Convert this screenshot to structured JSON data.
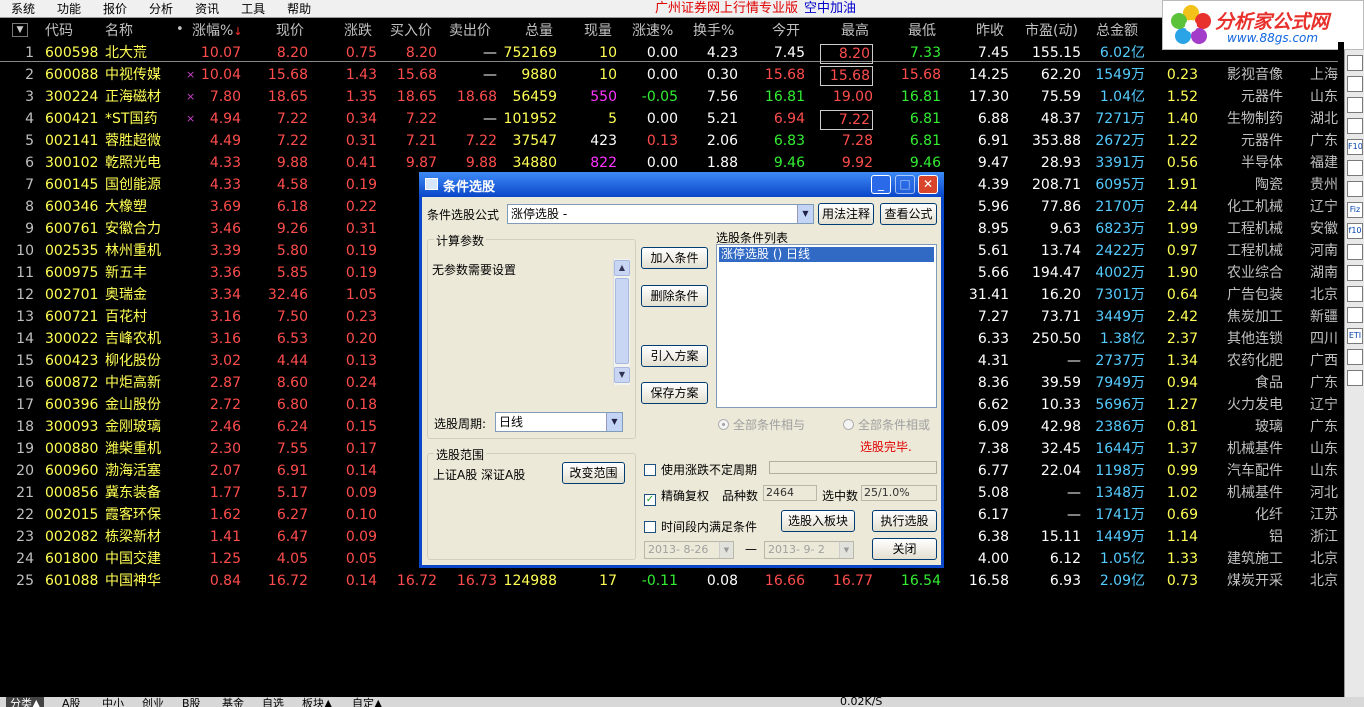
{
  "menu": {
    "items": [
      "系统",
      "功能",
      "报价",
      "分析",
      "资讯",
      "工具",
      "帮助"
    ],
    "title": "广州证券网上行情专业版",
    "subtitle": "空中加油"
  },
  "logo": {
    "name": "分析家公式网",
    "url": "www.88gs.com"
  },
  "table": {
    "headers": {
      "code": "代码",
      "name": "名称",
      "pct": "涨幅%",
      "price": "现价",
      "chg": "涨跌",
      "bid": "买入价",
      "ask": "卖出价",
      "vol": "总量",
      "curvol": "现量",
      "speed": "涨速%",
      "turnover": "换手%",
      "open": "今开",
      "high": "最高",
      "low": "最低",
      "prev": "昨收",
      "pe": "市盈(动)",
      "amount": "总金额",
      "pct_sort_arrow": "↓"
    },
    "rows": [
      {
        "no": "1",
        "code": "600598",
        "name": "北大荒",
        "mark": "",
        "pct": "10.07",
        "price": "8.20",
        "chg": "0.75",
        "bid": "8.20",
        "ask": "—",
        "vol": "752169",
        "curvol": "10",
        "speed": "0.00",
        "turnover": "4.23",
        "open": "7.45",
        "high": "8.20",
        "low": "7.33",
        "prev": "7.45",
        "pe": "155.15",
        "amount": "6.02亿",
        "vr": "",
        "industry": "",
        "region": ""
      },
      {
        "no": "2",
        "code": "600088",
        "name": "中视传媒",
        "mark": "×",
        "pct": "10.04",
        "price": "15.68",
        "chg": "1.43",
        "bid": "15.68",
        "ask": "—",
        "vol": "9880",
        "curvol": "10",
        "speed": "0.00",
        "turnover": "0.30",
        "open": "15.68",
        "high": "15.68",
        "low": "15.68",
        "prev": "14.25",
        "pe": "62.20",
        "amount": "1549万",
        "vr": "0.23",
        "industry": "影视音像",
        "region": "上海"
      },
      {
        "no": "3",
        "code": "300224",
        "name": "正海磁材",
        "mark": "×",
        "pct": "7.80",
        "price": "18.65",
        "chg": "1.35",
        "bid": "18.65",
        "ask": "18.68",
        "vol": "56459",
        "curvol": "550",
        "speed": "-0.05",
        "turnover": "7.56",
        "open": "16.81",
        "high": "19.00",
        "low": "16.81",
        "prev": "17.30",
        "pe": "75.59",
        "amount": "1.04亿",
        "vr": "1.52",
        "industry": "元器件",
        "region": "山东"
      },
      {
        "no": "4",
        "code": "600421",
        "name": "*ST国药",
        "mark": "×",
        "pct": "4.94",
        "price": "7.22",
        "chg": "0.34",
        "bid": "7.22",
        "ask": "—",
        "vol": "101952",
        "curvol": "5",
        "speed": "0.00",
        "turnover": "5.21",
        "open": "6.94",
        "high": "7.22",
        "low": "6.81",
        "prev": "6.88",
        "pe": "48.37",
        "amount": "7271万",
        "vr": "1.40",
        "industry": "生物制药",
        "region": "湖北"
      },
      {
        "no": "5",
        "code": "002141",
        "name": "蓉胜超微",
        "mark": "",
        "pct": "4.49",
        "price": "7.22",
        "chg": "0.31",
        "bid": "7.21",
        "ask": "7.22",
        "vol": "37547",
        "curvol": "423",
        "speed": "0.13",
        "turnover": "2.06",
        "open": "6.83",
        "high": "7.28",
        "low": "6.81",
        "prev": "6.91",
        "pe": "353.88",
        "amount": "2672万",
        "vr": "1.22",
        "industry": "元器件",
        "region": "广东"
      },
      {
        "no": "6",
        "code": "300102",
        "name": "乾照光电",
        "mark": "",
        "pct": "4.33",
        "price": "9.88",
        "chg": "0.41",
        "bid": "9.87",
        "ask": "9.88",
        "vol": "34880",
        "curvol": "822",
        "speed": "0.00",
        "turnover": "1.88",
        "open": "9.46",
        "high": "9.92",
        "low": "9.46",
        "prev": "9.47",
        "pe": "28.93",
        "amount": "3391万",
        "vr": "0.56",
        "industry": "半导体",
        "region": "福建"
      },
      {
        "no": "7",
        "code": "600145",
        "name": "国创能源",
        "mark": "",
        "pct": "4.33",
        "price": "4.58",
        "chg": "0.19",
        "bid": "4",
        "ask": "",
        "vol": "",
        "curvol": "",
        "speed": "",
        "turnover": "",
        "open": "",
        "high": "",
        "low": "",
        "prev": "4.39",
        "pe": "208.71",
        "amount": "6095万",
        "vr": "1.91",
        "industry": "陶瓷",
        "region": "贵州"
      },
      {
        "no": "8",
        "code": "600346",
        "name": "大橡塑",
        "mark": "",
        "pct": "3.69",
        "price": "6.18",
        "chg": "0.22",
        "bid": "6",
        "ask": "",
        "vol": "",
        "curvol": "",
        "speed": "",
        "turnover": "",
        "open": "",
        "high": "",
        "low": "",
        "prev": "5.96",
        "pe": "77.86",
        "amount": "2170万",
        "vr": "2.44",
        "industry": "化工机械",
        "region": "辽宁"
      },
      {
        "no": "9",
        "code": "600761",
        "name": "安徽合力",
        "mark": "",
        "pct": "3.46",
        "price": "9.26",
        "chg": "0.31",
        "bid": "9",
        "ask": "",
        "vol": "",
        "curvol": "",
        "speed": "",
        "turnover": "",
        "open": "",
        "high": "",
        "low": "",
        "prev": "8.95",
        "pe": "9.63",
        "amount": "6823万",
        "vr": "1.99",
        "industry": "工程机械",
        "region": "安徽"
      },
      {
        "no": "10",
        "code": "002535",
        "name": "林州重机",
        "mark": "",
        "pct": "3.39",
        "price": "5.80",
        "chg": "0.19",
        "bid": "5",
        "ask": "",
        "vol": "",
        "curvol": "",
        "speed": "",
        "turnover": "",
        "open": "",
        "high": "",
        "low": "",
        "prev": "5.61",
        "pe": "13.74",
        "amount": "2422万",
        "vr": "0.97",
        "industry": "工程机械",
        "region": "河南"
      },
      {
        "no": "11",
        "code": "600975",
        "name": "新五丰",
        "mark": "",
        "pct": "3.36",
        "price": "5.85",
        "chg": "0.19",
        "bid": "5",
        "ask": "",
        "vol": "",
        "curvol": "",
        "speed": "",
        "turnover": "",
        "open": "",
        "high": "",
        "low": "",
        "prev": "5.66",
        "pe": "194.47",
        "amount": "4002万",
        "vr": "1.90",
        "industry": "农业综合",
        "region": "湖南"
      },
      {
        "no": "12",
        "code": "002701",
        "name": "奥瑞金",
        "mark": "",
        "pct": "3.34",
        "price": "32.46",
        "chg": "1.05",
        "bid": "32",
        "ask": "",
        "vol": "",
        "curvol": "",
        "speed": "",
        "turnover": "",
        "open": "",
        "high": "",
        "low": "",
        "prev": "31.41",
        "pe": "16.20",
        "amount": "7301万",
        "vr": "0.64",
        "industry": "广告包装",
        "region": "北京"
      },
      {
        "no": "13",
        "code": "600721",
        "name": "百花村",
        "mark": "",
        "pct": "3.16",
        "price": "7.50",
        "chg": "0.23",
        "bid": "7",
        "ask": "",
        "vol": "",
        "curvol": "",
        "speed": "",
        "turnover": "",
        "open": "",
        "high": "",
        "low": "",
        "prev": "7.27",
        "pe": "73.71",
        "amount": "3449万",
        "vr": "2.42",
        "industry": "焦炭加工",
        "region": "新疆"
      },
      {
        "no": "14",
        "code": "300022",
        "name": "吉峰农机",
        "mark": "",
        "pct": "3.16",
        "price": "6.53",
        "chg": "0.20",
        "bid": "6",
        "ask": "",
        "vol": "",
        "curvol": "",
        "speed": "",
        "turnover": "",
        "open": "",
        "high": "",
        "low": "",
        "prev": "6.33",
        "pe": "250.50",
        "amount": "1.38亿",
        "vr": "2.37",
        "industry": "其他连锁",
        "region": "四川"
      },
      {
        "no": "15",
        "code": "600423",
        "name": "柳化股份",
        "mark": "",
        "pct": "3.02",
        "price": "4.44",
        "chg": "0.13",
        "bid": "4",
        "ask": "",
        "vol": "",
        "curvol": "",
        "speed": "",
        "turnover": "",
        "open": "",
        "high": "",
        "low": "",
        "prev": "4.31",
        "pe": "—",
        "amount": "2737万",
        "vr": "1.34",
        "industry": "农药化肥",
        "region": "广西"
      },
      {
        "no": "16",
        "code": "600872",
        "name": "中炬高新",
        "mark": "",
        "pct": "2.87",
        "price": "8.60",
        "chg": "0.24",
        "bid": "8",
        "ask": "",
        "vol": "",
        "curvol": "",
        "speed": "",
        "turnover": "",
        "open": "",
        "high": "",
        "low": "",
        "prev": "8.36",
        "pe": "39.59",
        "amount": "7949万",
        "vr": "0.94",
        "industry": "食品",
        "region": "广东"
      },
      {
        "no": "17",
        "code": "600396",
        "name": "金山股份",
        "mark": "",
        "pct": "2.72",
        "price": "6.80",
        "chg": "0.18",
        "bid": "6",
        "ask": "",
        "vol": "",
        "curvol": "",
        "speed": "",
        "turnover": "",
        "open": "",
        "high": "",
        "low": "",
        "prev": "6.62",
        "pe": "10.33",
        "amount": "5696万",
        "vr": "1.27",
        "industry": "火力发电",
        "region": "辽宁"
      },
      {
        "no": "18",
        "code": "300093",
        "name": "金刚玻璃",
        "mark": "",
        "pct": "2.46",
        "price": "6.24",
        "chg": "0.15",
        "bid": "6",
        "ask": "",
        "vol": "",
        "curvol": "",
        "speed": "",
        "turnover": "",
        "open": "",
        "high": "",
        "low": "",
        "prev": "6.09",
        "pe": "42.98",
        "amount": "2386万",
        "vr": "0.81",
        "industry": "玻璃",
        "region": "广东"
      },
      {
        "no": "19",
        "code": "000880",
        "name": "潍柴重机",
        "mark": "",
        "pct": "2.30",
        "price": "7.55",
        "chg": "0.17",
        "bid": "7",
        "ask": "",
        "vol": "",
        "curvol": "",
        "speed": "",
        "turnover": "",
        "open": "",
        "high": "",
        "low": "",
        "prev": "7.38",
        "pe": "32.45",
        "amount": "1644万",
        "vr": "1.37",
        "industry": "机械基件",
        "region": "山东"
      },
      {
        "no": "20",
        "code": "600960",
        "name": "渤海活塞",
        "mark": "",
        "pct": "2.07",
        "price": "6.91",
        "chg": "0.14",
        "bid": "6",
        "ask": "",
        "vol": "",
        "curvol": "",
        "speed": "",
        "turnover": "",
        "open": "",
        "high": "",
        "low": "",
        "prev": "6.77",
        "pe": "22.04",
        "amount": "1198万",
        "vr": "0.99",
        "industry": "汽车配件",
        "region": "山东"
      },
      {
        "no": "21",
        "code": "000856",
        "name": "冀东装备",
        "mark": "",
        "pct": "1.77",
        "price": "5.17",
        "chg": "0.09",
        "bid": "5",
        "ask": "",
        "vol": "",
        "curvol": "",
        "speed": "",
        "turnover": "",
        "open": "",
        "high": "",
        "low": "",
        "prev": "5.08",
        "pe": "—",
        "amount": "1348万",
        "vr": "1.02",
        "industry": "机械基件",
        "region": "河北"
      },
      {
        "no": "22",
        "code": "002015",
        "name": "霞客环保",
        "mark": "",
        "pct": "1.62",
        "price": "6.27",
        "chg": "0.10",
        "bid": "6",
        "ask": "",
        "vol": "",
        "curvol": "",
        "speed": "",
        "turnover": "",
        "open": "",
        "high": "",
        "low": "",
        "prev": "6.17",
        "pe": "—",
        "amount": "1741万",
        "vr": "0.69",
        "industry": "化纤",
        "region": "江苏"
      },
      {
        "no": "23",
        "code": "002082",
        "name": "栋梁新材",
        "mark": "",
        "pct": "1.41",
        "price": "6.47",
        "chg": "0.09",
        "bid": "6",
        "ask": "",
        "vol": "",
        "curvol": "",
        "speed": "",
        "turnover": "",
        "open": "",
        "high": "",
        "low": "",
        "prev": "6.38",
        "pe": "15.11",
        "amount": "1449万",
        "vr": "1.14",
        "industry": "铝",
        "region": "浙江"
      },
      {
        "no": "24",
        "code": "601800",
        "name": "中国交建",
        "mark": "",
        "pct": "1.25",
        "price": "4.05",
        "chg": "0.05",
        "bid": "4",
        "ask": "",
        "vol": "",
        "curvol": "",
        "speed": "",
        "turnover": "",
        "open": "",
        "high": "",
        "low": "",
        "prev": "4.00",
        "pe": "6.12",
        "amount": "1.05亿",
        "vr": "1.33",
        "industry": "建筑施工",
        "region": "北京"
      },
      {
        "no": "25",
        "code": "601088",
        "name": "中国神华",
        "mark": "",
        "pct": "0.84",
        "price": "16.72",
        "chg": "0.14",
        "bid": "16.72",
        "ask": "16.73",
        "vol": "124988",
        "curvol": "17",
        "speed": "-0.11",
        "turnover": "0.08",
        "open": "16.66",
        "high": "16.77",
        "low": "16.54",
        "prev": "16.58",
        "pe": "6.93",
        "amount": "2.09亿",
        "vr": "0.73",
        "industry": "煤炭开采",
        "region": "北京"
      }
    ]
  },
  "side_toolbar": {
    "icons": [
      "chart-icon",
      "line-icon",
      "kline-icon",
      "doc-icon",
      "f10-icon",
      "info-icon",
      "list-icon",
      "fiz-icon",
      "f10b-icon",
      "search-icon",
      "folder-icon",
      "sort-icon",
      "grid-icon",
      "eti-icon",
      "export-icon",
      "print-icon"
    ],
    "labels": [
      "",
      "",
      "",
      "",
      "F10",
      "",
      "",
      "Fiz",
      "f10",
      "",
      "",
      "",
      "",
      "ETI",
      "",
      ""
    ]
  },
  "bottom_tabs": [
    "分类▲",
    "A股",
    "中小",
    "创业",
    "B股",
    "基金",
    "自选",
    "板块▲",
    "自定▲"
  ],
  "bottom_status": "0.02K/S",
  "dialog": {
    "title": "条件选股",
    "formula_label": "条件选股公式",
    "formula_value": "涨停选股 -",
    "usage_button": "用法注释",
    "view_formula_button": "查看公式",
    "params_group": "计算参数",
    "params_text": "无参数需要设置",
    "period_label": "选股周期:",
    "period_value": "日线",
    "add_condition": "加入条件",
    "delete_condition": "删除条件",
    "import_plan": "引入方案",
    "save_plan": "保存方案",
    "condition_list_label": "选股条件列表",
    "condition_item": "涨停选股  () 日线",
    "radio_all_and": "全部条件相与",
    "radio_all_or": "全部条件相或",
    "status": "选股完毕.",
    "range_group": "选股范围",
    "range_text": "上证A股 深证A股",
    "change_range": "改变范围",
    "use_uncertain_period": "使用涨跌不定周期",
    "exact_restore": "精确复权",
    "stock_count_label": "品种数",
    "stock_count": "2464",
    "selected_count_label": "选中数",
    "selected_count": "25/1.0%",
    "time_condition": "时间段内满足条件",
    "date_from": "2013- 8-26",
    "date_to": "2013- 9- 2",
    "date_sep": "—",
    "select_to_block": "选股入板块",
    "execute_select": "执行选股",
    "close": "关闭"
  }
}
